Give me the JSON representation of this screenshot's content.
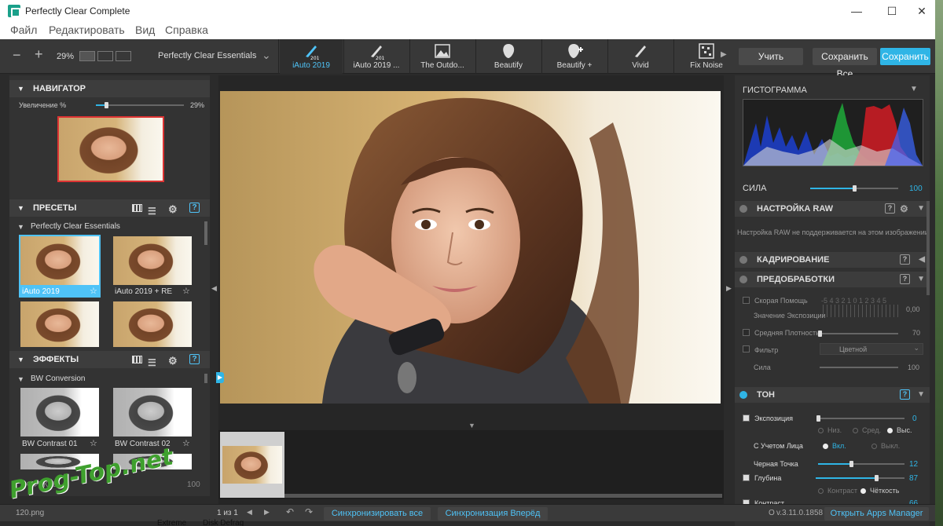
{
  "window": {
    "title": "Perfectly Clear Complete"
  },
  "menu": [
    "Файл",
    "Редактировать",
    "Вид",
    "Справка"
  ],
  "toolbar": {
    "zoom": "29%",
    "preset_set": "Perfectly Clear Essentials",
    "presets": [
      {
        "label": "iAuto 2019",
        "badge": "2019",
        "icon": "brush-icon"
      },
      {
        "label": "iAuto 2019 ...",
        "badge": "2019",
        "icon": "brush-icon"
      },
      {
        "label": "The Outdo...",
        "icon": "landscape-icon"
      },
      {
        "label": "Beautify",
        "icon": "face-icon"
      },
      {
        "label": "Beautify +",
        "icon": "face-plus-icon"
      },
      {
        "label": "Vivid",
        "icon": "brush-icon"
      },
      {
        "label": "Fix Noise",
        "icon": "noise-icon"
      }
    ],
    "learn": "Учить",
    "save_all": "Сохранить Все",
    "save": "Сохранить"
  },
  "navigator": {
    "title": "НАВИГАТОР",
    "zoom_label": "Увеличение %",
    "zoom_value": "29%",
    "zoom_fraction": 0.12
  },
  "presets_panel": {
    "title": "ПРЕСЕТЫ",
    "group": "Perfectly Clear Essentials",
    "items": [
      {
        "label": "iAuto 2019"
      },
      {
        "label": "iAuto 2019 + RE"
      }
    ]
  },
  "effects_panel": {
    "title": "ЭФФЕКТЫ",
    "group": "BW Conversion",
    "items": [
      {
        "label": "BW Contrast 01"
      },
      {
        "label": "BW Contrast 02"
      }
    ],
    "footer": "ЭФФЕКТЫ",
    "footer_value": "100"
  },
  "histogram": {
    "title": "ГИСТОГРАММА"
  },
  "strength": {
    "label": "СИЛА",
    "value": "100",
    "fraction": 0.5
  },
  "raw": {
    "title": "НАСТРОЙКА RAW",
    "msg": "Настройка RAW не поддерживается на этом изображении"
  },
  "crop": {
    "title": "КАДРИРОВАНИЕ"
  },
  "preprocess": {
    "title": "ПРЕДОБРАБОТКИ",
    "quick": "Скорая Помощь",
    "scale": "-5 4 3 2 1 0 1 2 3 4 5",
    "exposure_value_label": "Значение Экспозиции",
    "exposure_value": "0,00",
    "density_label": "Средняя Плотность",
    "density": "70",
    "density_fraction": 0.0,
    "filter_label": "Фильтр",
    "filter_value": "Цветной",
    "force_label": "Сила",
    "force": "100",
    "force_fraction": 0.45
  },
  "tone": {
    "title": "ТОН",
    "exposure_label": "Экспозиция",
    "exposure": "0",
    "exposure_fraction": 0.0,
    "radios": [
      "Низ.",
      "Сред.",
      "Выс."
    ],
    "face_label": "С Учетом Лица",
    "face_on": "Вкл.",
    "face_off": "Выкл.",
    "black_label": "Черная Точка",
    "black": "12",
    "black_fraction": 0.38,
    "depth_label": "Глубина",
    "depth": "87",
    "depth_fraction": 0.68,
    "contrast": "Контраст",
    "clarity": "Чёткость",
    "cut_label": "Контраст",
    "cut_value": "66"
  },
  "status": {
    "file": "120.png",
    "page": "1 из 1",
    "sync_all": "Синхронизировать все",
    "sync_forward": "Синхронизация Вперёд",
    "version": "v.3.11.0.1858",
    "apps": "Открыть Apps Manager"
  },
  "desktop": {
    "items": [
      "Extreme",
      "Disk Defrag"
    ]
  },
  "watermark": "Prog-Top.net"
}
